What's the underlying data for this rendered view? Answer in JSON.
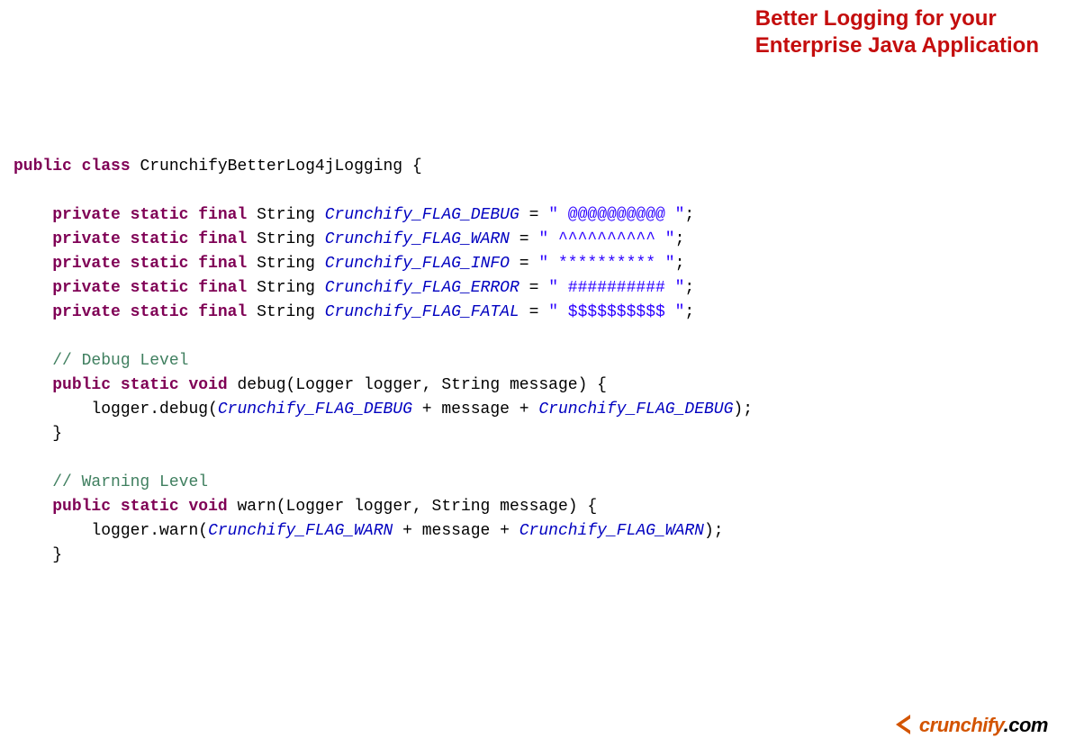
{
  "headline": {
    "line1": "Better Logging for your",
    "line2": "Enterprise Java Application"
  },
  "code": {
    "kw_public": "public",
    "kw_class": "class",
    "class_name": "CrunchifyBetterLog4jLogging",
    "brace_open": "{",
    "kw_private": "private",
    "kw_static": "static",
    "kw_final": "final",
    "kw_void": "void",
    "type_string": "String",
    "field_debug": "Crunchify_FLAG_DEBUG",
    "field_warn": "Crunchify_FLAG_WARN",
    "field_info": "Crunchify_FLAG_INFO",
    "field_error": "Crunchify_FLAG_ERROR",
    "field_fatal": "Crunchify_FLAG_FATAL",
    "eq": " = ",
    "str_debug": "\" @@@@@@@@@@ \"",
    "str_warn": "\" ^^^^^^^^^^ \"",
    "str_info": "\" ********** \"",
    "str_error": "\" ########## \"",
    "str_fatal": "\" $$$$$$$$$$ \"",
    "semi": ";",
    "cmt_debug": "// Debug Level",
    "cmt_warn": "// Warning Level",
    "method_debug": "debug",
    "method_warn": "warn",
    "params": "(Logger logger, String message) {",
    "call_logger": "logger",
    "dot": ".",
    "call_debug": "debug",
    "call_warn": "warn",
    "po": "(",
    "plus_msg_plus": " + message + ",
    "pc_semi": ");",
    "brace_close": "}"
  },
  "logo": {
    "name": "crunchify",
    "dotcom": ".com"
  }
}
